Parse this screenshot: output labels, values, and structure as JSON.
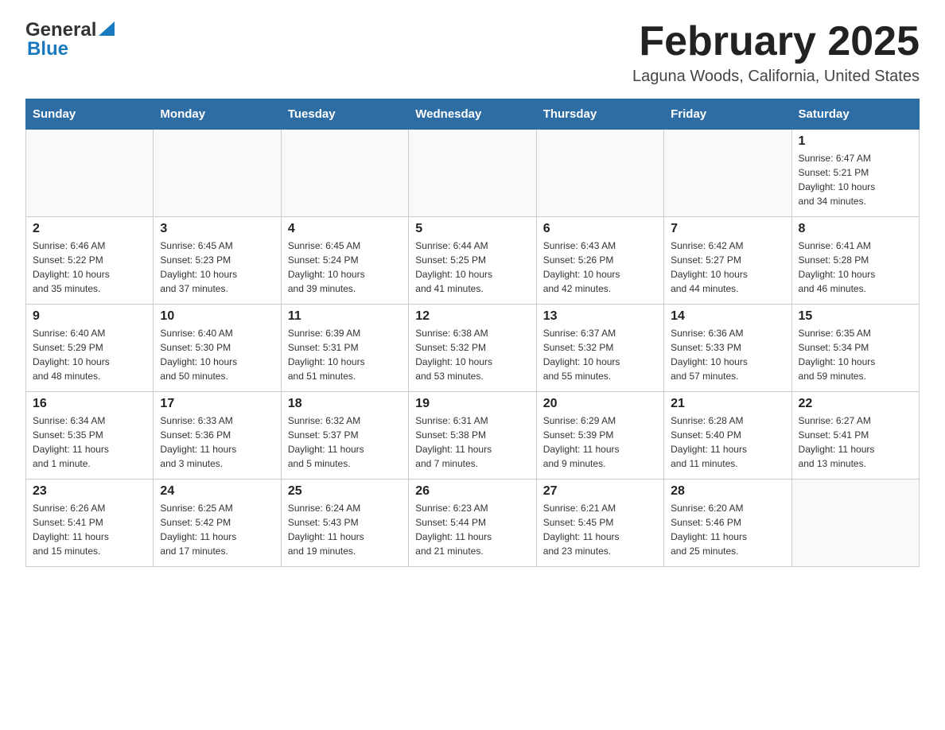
{
  "header": {
    "month_title": "February 2025",
    "location": "Laguna Woods, California, United States",
    "logo_general": "General",
    "logo_blue": "Blue"
  },
  "weekdays": [
    "Sunday",
    "Monday",
    "Tuesday",
    "Wednesday",
    "Thursday",
    "Friday",
    "Saturday"
  ],
  "weeks": [
    [
      {
        "day": "",
        "info": ""
      },
      {
        "day": "",
        "info": ""
      },
      {
        "day": "",
        "info": ""
      },
      {
        "day": "",
        "info": ""
      },
      {
        "day": "",
        "info": ""
      },
      {
        "day": "",
        "info": ""
      },
      {
        "day": "1",
        "info": "Sunrise: 6:47 AM\nSunset: 5:21 PM\nDaylight: 10 hours\nand 34 minutes."
      }
    ],
    [
      {
        "day": "2",
        "info": "Sunrise: 6:46 AM\nSunset: 5:22 PM\nDaylight: 10 hours\nand 35 minutes."
      },
      {
        "day": "3",
        "info": "Sunrise: 6:45 AM\nSunset: 5:23 PM\nDaylight: 10 hours\nand 37 minutes."
      },
      {
        "day": "4",
        "info": "Sunrise: 6:45 AM\nSunset: 5:24 PM\nDaylight: 10 hours\nand 39 minutes."
      },
      {
        "day": "5",
        "info": "Sunrise: 6:44 AM\nSunset: 5:25 PM\nDaylight: 10 hours\nand 41 minutes."
      },
      {
        "day": "6",
        "info": "Sunrise: 6:43 AM\nSunset: 5:26 PM\nDaylight: 10 hours\nand 42 minutes."
      },
      {
        "day": "7",
        "info": "Sunrise: 6:42 AM\nSunset: 5:27 PM\nDaylight: 10 hours\nand 44 minutes."
      },
      {
        "day": "8",
        "info": "Sunrise: 6:41 AM\nSunset: 5:28 PM\nDaylight: 10 hours\nand 46 minutes."
      }
    ],
    [
      {
        "day": "9",
        "info": "Sunrise: 6:40 AM\nSunset: 5:29 PM\nDaylight: 10 hours\nand 48 minutes."
      },
      {
        "day": "10",
        "info": "Sunrise: 6:40 AM\nSunset: 5:30 PM\nDaylight: 10 hours\nand 50 minutes."
      },
      {
        "day": "11",
        "info": "Sunrise: 6:39 AM\nSunset: 5:31 PM\nDaylight: 10 hours\nand 51 minutes."
      },
      {
        "day": "12",
        "info": "Sunrise: 6:38 AM\nSunset: 5:32 PM\nDaylight: 10 hours\nand 53 minutes."
      },
      {
        "day": "13",
        "info": "Sunrise: 6:37 AM\nSunset: 5:32 PM\nDaylight: 10 hours\nand 55 minutes."
      },
      {
        "day": "14",
        "info": "Sunrise: 6:36 AM\nSunset: 5:33 PM\nDaylight: 10 hours\nand 57 minutes."
      },
      {
        "day": "15",
        "info": "Sunrise: 6:35 AM\nSunset: 5:34 PM\nDaylight: 10 hours\nand 59 minutes."
      }
    ],
    [
      {
        "day": "16",
        "info": "Sunrise: 6:34 AM\nSunset: 5:35 PM\nDaylight: 11 hours\nand 1 minute."
      },
      {
        "day": "17",
        "info": "Sunrise: 6:33 AM\nSunset: 5:36 PM\nDaylight: 11 hours\nand 3 minutes."
      },
      {
        "day": "18",
        "info": "Sunrise: 6:32 AM\nSunset: 5:37 PM\nDaylight: 11 hours\nand 5 minutes."
      },
      {
        "day": "19",
        "info": "Sunrise: 6:31 AM\nSunset: 5:38 PM\nDaylight: 11 hours\nand 7 minutes."
      },
      {
        "day": "20",
        "info": "Sunrise: 6:29 AM\nSunset: 5:39 PM\nDaylight: 11 hours\nand 9 minutes."
      },
      {
        "day": "21",
        "info": "Sunrise: 6:28 AM\nSunset: 5:40 PM\nDaylight: 11 hours\nand 11 minutes."
      },
      {
        "day": "22",
        "info": "Sunrise: 6:27 AM\nSunset: 5:41 PM\nDaylight: 11 hours\nand 13 minutes."
      }
    ],
    [
      {
        "day": "23",
        "info": "Sunrise: 6:26 AM\nSunset: 5:41 PM\nDaylight: 11 hours\nand 15 minutes."
      },
      {
        "day": "24",
        "info": "Sunrise: 6:25 AM\nSunset: 5:42 PM\nDaylight: 11 hours\nand 17 minutes."
      },
      {
        "day": "25",
        "info": "Sunrise: 6:24 AM\nSunset: 5:43 PM\nDaylight: 11 hours\nand 19 minutes."
      },
      {
        "day": "26",
        "info": "Sunrise: 6:23 AM\nSunset: 5:44 PM\nDaylight: 11 hours\nand 21 minutes."
      },
      {
        "day": "27",
        "info": "Sunrise: 6:21 AM\nSunset: 5:45 PM\nDaylight: 11 hours\nand 23 minutes."
      },
      {
        "day": "28",
        "info": "Sunrise: 6:20 AM\nSunset: 5:46 PM\nDaylight: 11 hours\nand 25 minutes."
      },
      {
        "day": "",
        "info": ""
      }
    ]
  ]
}
